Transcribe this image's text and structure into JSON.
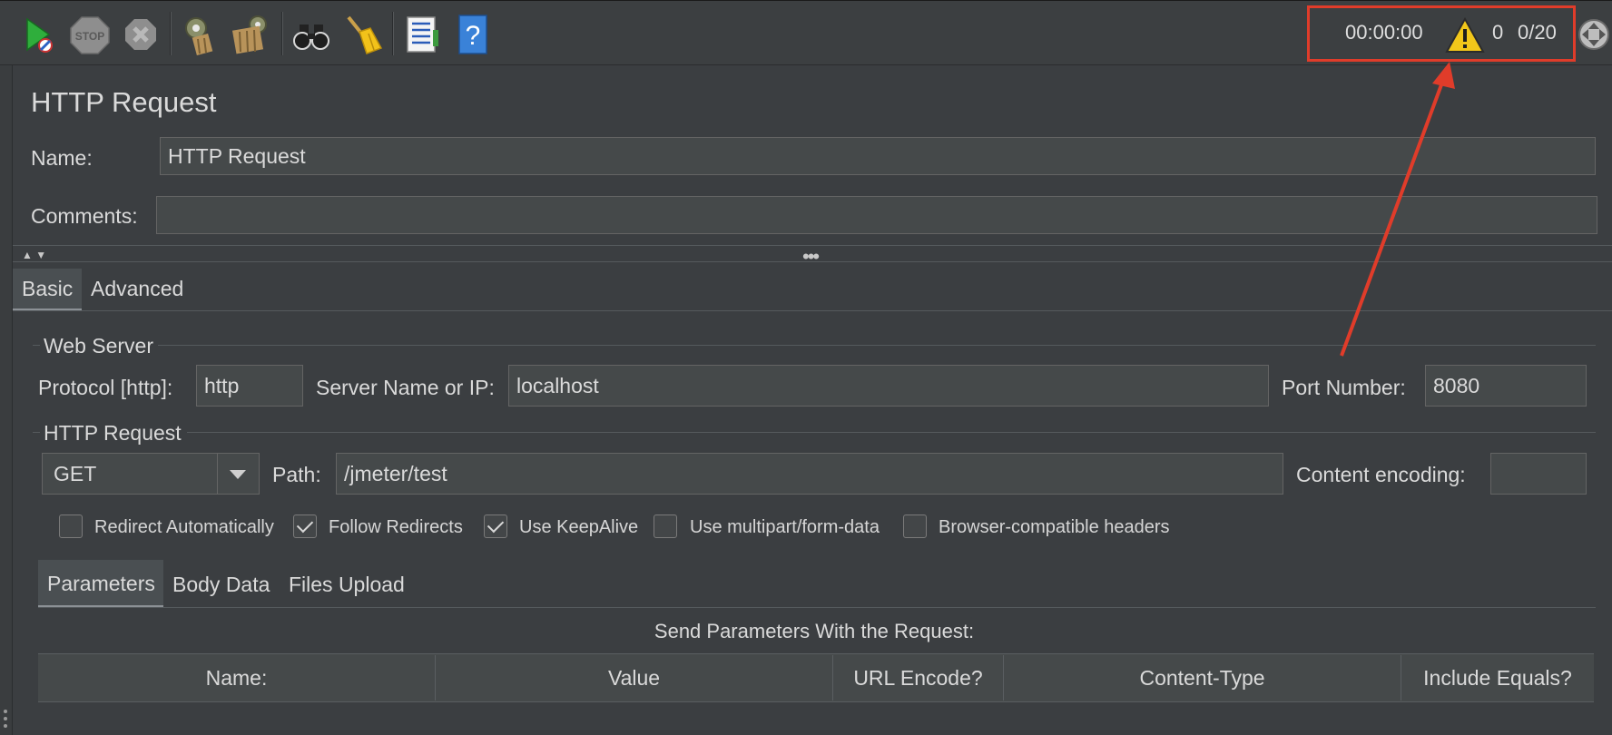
{
  "toolbar": {
    "buttons": [
      {
        "name": "start-icon"
      },
      {
        "name": "stop-icon",
        "label": "STOP"
      },
      {
        "name": "shutdown-icon"
      },
      {
        "name": "clear-icon"
      },
      {
        "name": "clear-all-icon"
      },
      {
        "name": "search-icon"
      },
      {
        "name": "reset-search-icon"
      },
      {
        "name": "function-helper-icon"
      },
      {
        "name": "help-icon",
        "label": "?"
      }
    ],
    "status": {
      "elapsed_time": "00:00:00",
      "error_count": "0",
      "threads": "0/20"
    }
  },
  "panel": {
    "title": "HTTP Request",
    "name_label": "Name:",
    "name_value": "HTTP Request",
    "comments_label": "Comments:",
    "comments_value": ""
  },
  "tabs": {
    "basic": "Basic",
    "advanced": "Advanced",
    "active": "Basic"
  },
  "web_server": {
    "legend": "Web Server",
    "protocol_label": "Protocol [http]:",
    "protocol_value": "http",
    "server_label": "Server Name or IP:",
    "server_value": "localhost",
    "port_label": "Port Number:",
    "port_value": "8080"
  },
  "http_request": {
    "legend": "HTTP Request",
    "method": "GET",
    "path_label": "Path:",
    "path_value": "/jmeter/test",
    "encoding_label": "Content encoding:",
    "encoding_value": ""
  },
  "options": [
    {
      "label": "Redirect Automatically",
      "checked": false
    },
    {
      "label": "Follow Redirects",
      "checked": true
    },
    {
      "label": "Use KeepAlive",
      "checked": true
    },
    {
      "label": "Use multipart/form-data",
      "checked": false
    },
    {
      "label": "Browser-compatible headers",
      "checked": false
    }
  ],
  "subtabs": {
    "parameters": "Parameters",
    "body_data": "Body Data",
    "files_upload": "Files Upload",
    "active": "Parameters"
  },
  "parameters_table": {
    "caption": "Send Parameters With the Request:",
    "columns": [
      "Name:",
      "Value",
      "URL Encode?",
      "Content-Type",
      "Include Equals?"
    ]
  },
  "colors": {
    "annotation": "#e03c2a",
    "background": "#3b3e41"
  }
}
